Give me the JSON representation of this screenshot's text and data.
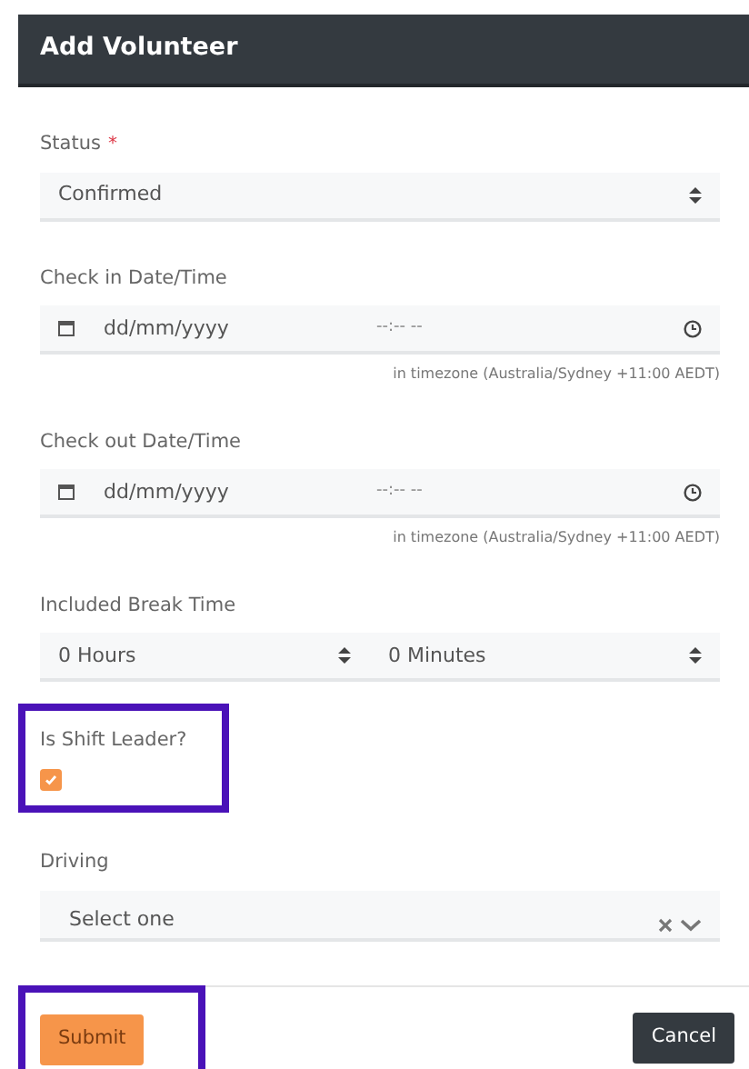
{
  "header": {
    "title": "Add Volunteer"
  },
  "fields": [
    {
      "kind": "select",
      "label": "Status",
      "required_mark": "*",
      "value": "Confirmed"
    },
    {
      "kind": "datetime",
      "label": "Check in Date/Time",
      "date_placeholder": "dd/mm/yyyy",
      "time_placeholder": "--:-- --",
      "hint": "in timezone (Australia/Sydney +11:00 AEDT)"
    },
    {
      "kind": "datetime",
      "label": "Check out Date/Time",
      "date_placeholder": "dd/mm/yyyy",
      "time_placeholder": "--:-- --",
      "hint": "in timezone (Australia/Sydney +11:00 AEDT)"
    },
    {
      "kind": "pair",
      "label": "Included Break Time",
      "values": [
        "0 Hours",
        "0 Minutes"
      ]
    },
    {
      "kind": "checkbox",
      "label": "Is Shift Leader?",
      "checked": true,
      "highlighted": true
    },
    {
      "kind": "combo",
      "label": "Driving",
      "placeholder": "Select one"
    }
  ],
  "footer": {
    "submit": "Submit",
    "submit_highlighted": true,
    "cancel": "Cancel"
  }
}
